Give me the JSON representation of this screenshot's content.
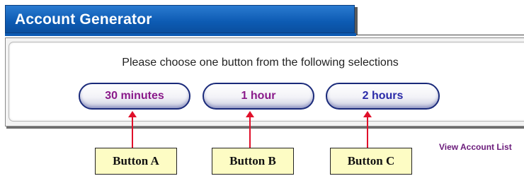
{
  "header": {
    "title": "Account Generator"
  },
  "panel": {
    "instruction": "Please choose one button from the following selections",
    "buttons": [
      {
        "label": "30 minutes",
        "color": "#8a1a8a"
      },
      {
        "label": "1 hour",
        "color": "#8a1a8a"
      },
      {
        "label": "2 hours",
        "color": "#2a2aa8"
      }
    ]
  },
  "annotations": [
    {
      "label": "Button A"
    },
    {
      "label": "Button B"
    },
    {
      "label": "Button C"
    }
  ],
  "links": {
    "view_account_list": "View Account List"
  },
  "colors": {
    "title_bar": "#0d5bb3",
    "arrow": "#e0102a",
    "callout_bg": "#fdfcc4"
  }
}
